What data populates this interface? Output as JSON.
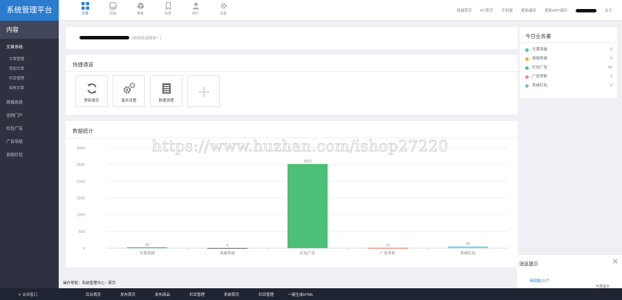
{
  "app": {
    "title": "系统管理平台"
  },
  "topnav": [
    {
      "label": "文章",
      "icon": "grid-icon",
      "active": true
    },
    {
      "label": "页面",
      "icon": "inbox-icon",
      "active": false
    },
    {
      "label": "模板",
      "icon": "cube-icon",
      "active": false
    },
    {
      "label": "标签",
      "icon": "bookmark-icon",
      "active": false
    },
    {
      "label": "用户",
      "icon": "user-icon",
      "active": false
    },
    {
      "label": "设置",
      "icon": "gear-icon",
      "active": false
    }
  ],
  "toplinks": [
    "商城首页",
    "PC首页",
    "手机版",
    "更新缓存",
    "更新APP缓存",
    "关于"
  ],
  "sidebar": {
    "title": "内容",
    "menu": [
      {
        "label": "文章系统",
        "sub": [
          "文章管理",
          "添加文章",
          "栏目管理",
          "审核文章"
        ]
      },
      {
        "label": "商城系统"
      },
      {
        "label": "全网门户"
      },
      {
        "label": "红包广告"
      },
      {
        "label": "广告导航"
      },
      {
        "label": "系统红包"
      }
    ]
  },
  "welcome": {
    "text": "(你好欢迎回来！)"
  },
  "quick": {
    "title": "快捷通道",
    "items": [
      {
        "label": "更新缓存",
        "icon": "refresh-icon"
      },
      {
        "label": "基本设置",
        "icon": "gears-icon"
      },
      {
        "label": "数据清理",
        "icon": "document-icon"
      },
      {
        "label": "",
        "icon": "plus-icon"
      }
    ]
  },
  "chart": {
    "title": "数据统计"
  },
  "chart_data": {
    "type": "bar",
    "categories": [
      "文章系统",
      "商城系统",
      "红包广告",
      "广告导航",
      "系统红包"
    ],
    "values": [
      25,
      4,
      2520,
      10,
      50
    ],
    "value_labels": [
      "25",
      "4",
      "2520",
      "10",
      "50"
    ],
    "colors": [
      "#3aa5c8",
      "#777777",
      "#4cbf78",
      "#e8746a",
      "#78d8e8"
    ],
    "ylim": [
      0,
      3000
    ],
    "yticks": [
      0,
      500,
      1000,
      1500,
      2000,
      2500,
      3000
    ],
    "grid": true
  },
  "today": {
    "title": "今日业务量",
    "items": [
      {
        "label": "文章系统",
        "count": "0",
        "color": "#44c4c9"
      },
      {
        "label": "商城系统",
        "count": "0",
        "color": "#f0ad2c"
      },
      {
        "label": "红包广告",
        "count": "60",
        "color": "#56c27b"
      },
      {
        "label": "广告导航",
        "count": "2",
        "color": "#f08090"
      },
      {
        "label": "系统红包",
        "count": "3",
        "color": "#7ab3e0"
      }
    ]
  },
  "message": {
    "title": "消息提示",
    "line": "待回复(1)个",
    "nomore": "不再提示"
  },
  "breadcrumb": "操作导航：系统管理中心 - 首页",
  "bottombar": {
    "close_label": "关闭窗口",
    "items": [
      "后台首页",
      "发布首页",
      "发布商品",
      "栏目管理",
      "系统首页",
      "栏目管理",
      "一键生成HTML"
    ]
  },
  "watermark": "https://www.huzhan.com/ishop27220"
}
